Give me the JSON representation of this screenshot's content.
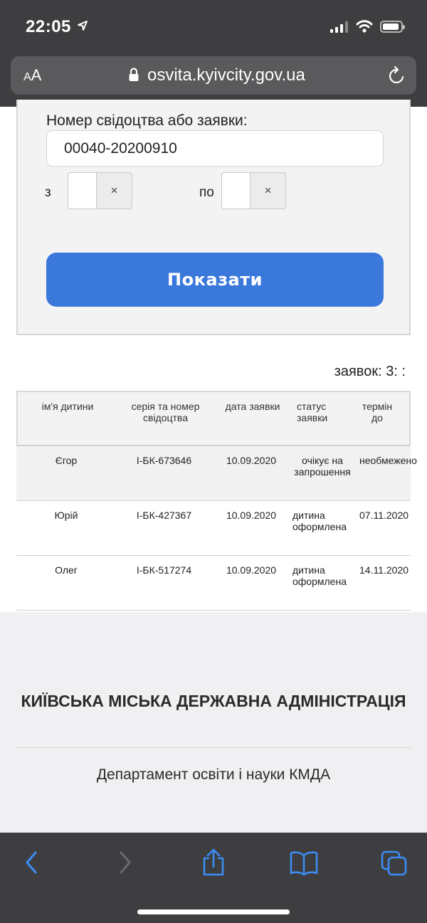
{
  "status_bar": {
    "time": "22:05"
  },
  "browser": {
    "text_size_label": "AA",
    "url": "osvita.kyivcity.gov.ua"
  },
  "form": {
    "field_label": "Номер свідоцтва або заявки:",
    "certificate_value": "00040-20200910",
    "from_label": "з",
    "to_label": "по",
    "clear_symbol": "×",
    "show_button_label": "Показати"
  },
  "results": {
    "count_text": "заявок: 3: :",
    "columns": [
      "ім'я дитини",
      "серія та номер свідоцтва",
      "дата заявки",
      "статус заявки",
      "термін до"
    ],
    "rows": [
      {
        "name": "Єгор",
        "certificate": "І-БК-673646",
        "date": "10.09.2020",
        "status": "очікує на запрошення",
        "term": "необмежено"
      },
      {
        "name": "Юрій",
        "certificate": "І-БК-427367",
        "date": "10.09.2020",
        "status": "дитина оформлена",
        "term": "07.11.2020"
      },
      {
        "name": "Олег",
        "certificate": "І-БК-517274",
        "date": "10.09.2020",
        "status": "дитина оформлена",
        "term": "14.11.2020"
      }
    ]
  },
  "footer": {
    "org_name": "КИЇВСЬКА МІСЬКА ДЕРЖАВНА АДМІНІСТРАЦІЯ",
    "department": "Департамент освіти і науки КМДА"
  },
  "toolbar": {
    "icons": [
      "back-icon",
      "forward-icon",
      "share-icon",
      "bookmarks-icon",
      "tabs-icon"
    ]
  },
  "colors": {
    "accent": "#3b78dc",
    "chrome": "#3e3e40",
    "toolbar_icon": "#3b8cf5"
  }
}
